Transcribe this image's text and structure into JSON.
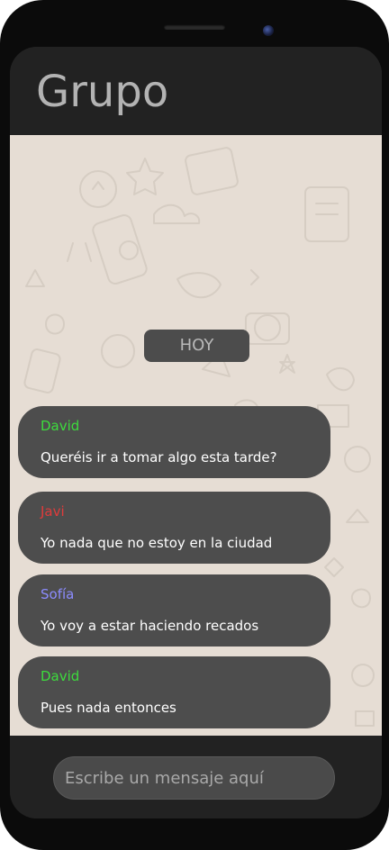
{
  "app": {
    "title": "Grupo"
  },
  "chat": {
    "date_label": "HOY",
    "messages": [
      {
        "sender": "David",
        "sender_color": "#3ddc3d",
        "text": "Queréis ir a tomar algo esta tarde?"
      },
      {
        "sender": "Javi",
        "sender_color": "#e03b3b",
        "text": "Yo nada que no estoy en la ciudad"
      },
      {
        "sender": "Sofía",
        "sender_color": "#8c8cff",
        "text": "Yo voy a estar haciendo recados"
      },
      {
        "sender": "David",
        "sender_color": "#3ddc3d",
        "text": "Pues nada entonces"
      }
    ]
  },
  "composer": {
    "placeholder": "Escribe un mensaje aquí",
    "value": ""
  },
  "colors": {
    "header_bg": "#222222",
    "chat_bg": "#e6ddd4",
    "bubble_bg": "#4d4d4d",
    "message_text": "#ffffff"
  }
}
